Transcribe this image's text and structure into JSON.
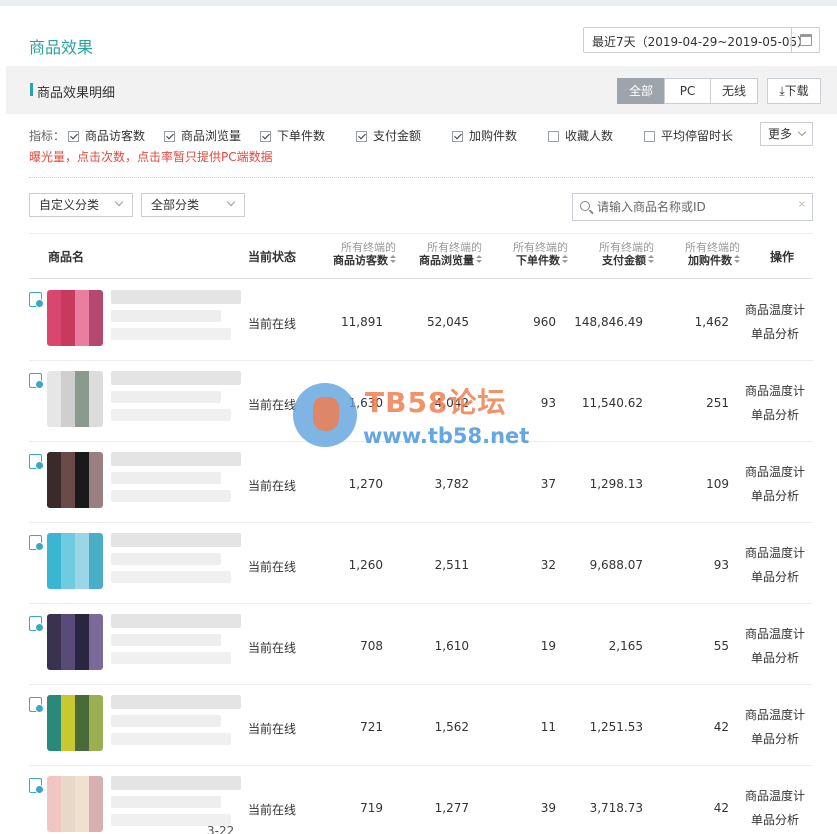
{
  "page": {
    "title": "商品效果"
  },
  "date_range": {
    "label": "最近7天（2019-04-29~2019-05-05）"
  },
  "section": {
    "title": "商品效果明细",
    "tabs": [
      {
        "label": "全部",
        "active": true
      },
      {
        "label": "PC",
        "active": false
      },
      {
        "label": "无线",
        "active": false
      }
    ],
    "download_label": "下载"
  },
  "metrics": {
    "label": "指标：",
    "items": [
      {
        "label": "商品访客数",
        "checked": true
      },
      {
        "label": "商品浏览量",
        "checked": true
      },
      {
        "label": "下单件数",
        "checked": true
      },
      {
        "label": "支付金额",
        "checked": true
      },
      {
        "label": "加购件数",
        "checked": true
      },
      {
        "label": "收藏人数",
        "checked": false
      },
      {
        "label": "平均停留时长",
        "checked": false
      }
    ],
    "more_label": "更多",
    "notice": "曝光量，点击次数，点击率暂只提供PC端数据"
  },
  "filters": {
    "custom_category": "自定义分类",
    "all_category": "全部分类",
    "search_placeholder": "请输入商品名称或ID",
    "clear": "×"
  },
  "table": {
    "headers": {
      "product": "商品名",
      "status": "当前状态",
      "visitors_small": "所有终端的",
      "visitors": "商品访客数",
      "views_small": "所有终端的",
      "views": "商品浏览量",
      "orders_small": "所有终端的",
      "orders": "下单件数",
      "payment_small": "所有终端的",
      "payment": "支付金额",
      "cart_small": "所有终端的",
      "cart": "加购件数",
      "ops": "操作"
    },
    "rows": [
      {
        "status": "当前在线",
        "visitors": "11,891",
        "views": "52,045",
        "orders": "960",
        "payment": "148,846.49",
        "cart": "1,462",
        "op1": "商品温度计",
        "op2": "单品分析"
      },
      {
        "status": "当前在线",
        "visitors": "1,630",
        "views": "4,042",
        "orders": "93",
        "payment": "11,540.62",
        "cart": "251",
        "op1": "商品温度计",
        "op2": "单品分析"
      },
      {
        "status": "当前在线",
        "visitors": "1,270",
        "views": "3,782",
        "orders": "37",
        "payment": "1,298.13",
        "cart": "109",
        "op1": "商品温度计",
        "op2": "单品分析"
      },
      {
        "status": "当前在线",
        "visitors": "1,260",
        "views": "2,511",
        "orders": "32",
        "payment": "9,688.07",
        "cart": "93",
        "op1": "商品温度计",
        "op2": "单品分析"
      },
      {
        "status": "当前在线",
        "visitors": "708",
        "views": "1,610",
        "orders": "19",
        "payment": "2,165",
        "cart": "55",
        "op1": "商品温度计",
        "op2": "单品分析"
      },
      {
        "status": "当前在线",
        "visitors": "721",
        "views": "1,562",
        "orders": "11",
        "payment": "1,251.53",
        "cart": "42",
        "op1": "商品温度计",
        "op2": "单品分析"
      },
      {
        "status": "当前在线",
        "visitors": "719",
        "views": "1,277",
        "orders": "39",
        "payment": "3,718.73",
        "cart": "42",
        "op1": "商品温度计",
        "op2": "单品分析",
        "partial_date": "3-22"
      }
    ]
  },
  "watermark": {
    "title": "TB58论坛",
    "url": "www.tb58.net"
  }
}
